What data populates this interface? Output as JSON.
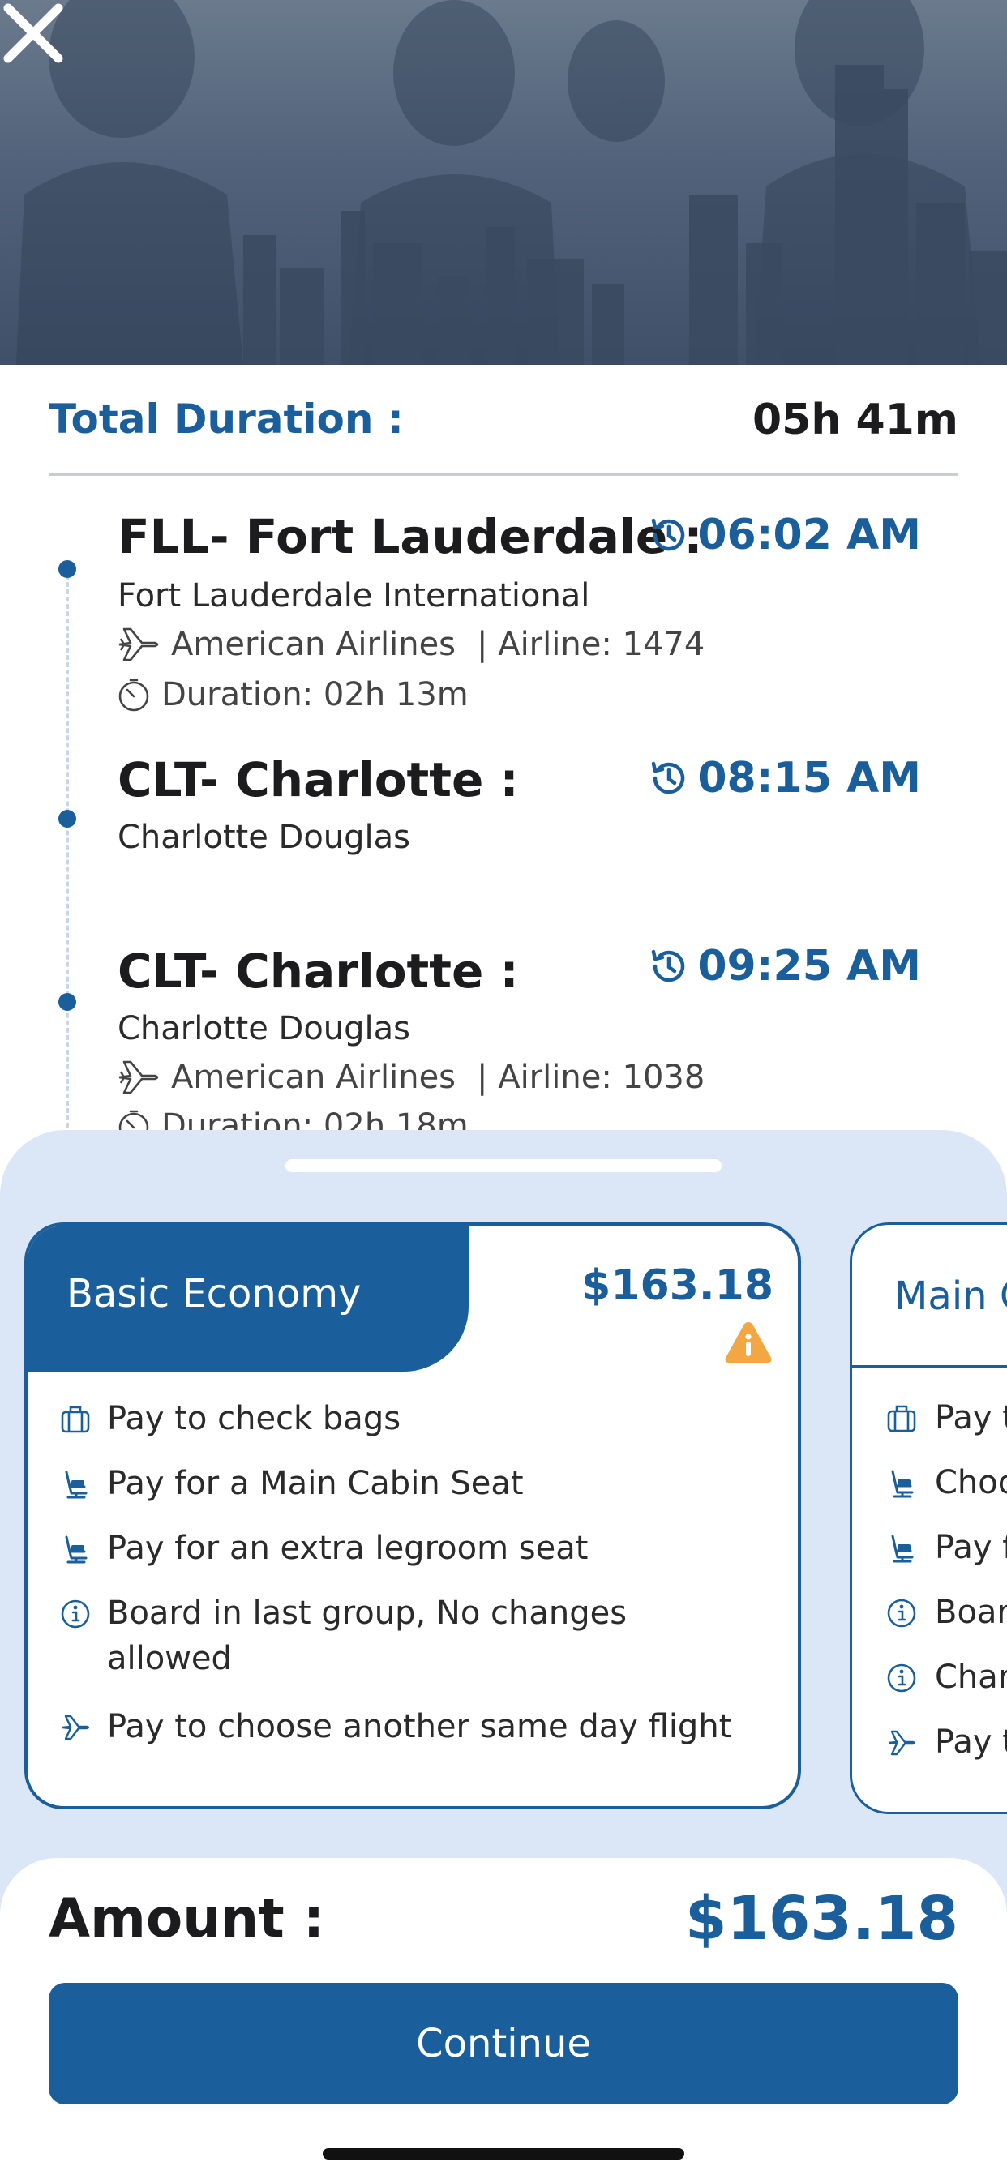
{
  "header": {
    "close_icon": "close-icon"
  },
  "summary": {
    "total_label": "Total Duration :",
    "total_value": "05h 41m"
  },
  "segments": [
    {
      "city": "FLL- Fort Lauderdale :",
      "time": "06:02 AM",
      "airport": "Fort Lauderdale International",
      "airline": "American Airlines",
      "flight": "| Airline: 1474",
      "duration": "Duration: 02h 13m"
    },
    {
      "city": "CLT- Charlotte :",
      "time": "08:15 AM",
      "airport": "Charlotte Douglas"
    },
    {
      "city": "CLT- Charlotte :",
      "time": "09:25 AM",
      "airport": "Charlotte Douglas",
      "airline": "American Airlines",
      "flight": "| Airline: 1038",
      "duration": "Duration: 02h 18m"
    }
  ],
  "fares": [
    {
      "name": "Basic Economy",
      "price": "$163.18",
      "features": [
        {
          "icon": "luggage-icon",
          "text": "Pay to check bags"
        },
        {
          "icon": "seat-icon",
          "text": "Pay for a Main Cabin Seat"
        },
        {
          "icon": "seat-icon",
          "text": "Pay for an extra legroom seat"
        },
        {
          "icon": "info-icon",
          "text": "Board in last group, No changes allowed"
        },
        {
          "icon": "plane-icon",
          "text": "Pay to choose another same day flight"
        }
      ]
    },
    {
      "name": "Main C",
      "features": [
        {
          "icon": "luggage-icon",
          "text": "Pay t"
        },
        {
          "icon": "seat-icon",
          "text": "Choo"
        },
        {
          "icon": "seat-icon",
          "text": "Pay f"
        },
        {
          "icon": "info-icon",
          "text": "Boar"
        },
        {
          "icon": "info-icon",
          "text": "Char"
        },
        {
          "icon": "plane-icon",
          "text": "Pay t"
        }
      ]
    }
  ],
  "footer": {
    "amount_label": "Amount :",
    "amount_value": "$163.18",
    "continue_label": "Continue"
  },
  "colors": {
    "primary": "#1a5f9c",
    "sheet_bg": "#dbe7f7",
    "warning": "#f2a742"
  }
}
